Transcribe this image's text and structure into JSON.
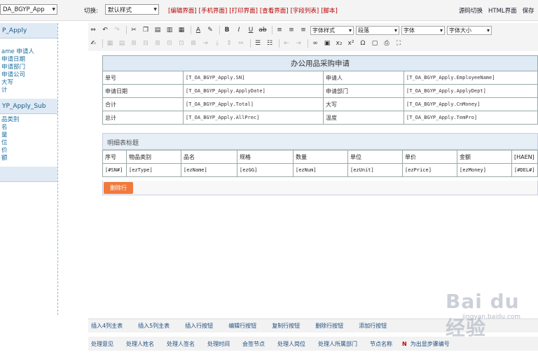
{
  "topbar": {
    "form_select": "DA_BGYP_App",
    "mode_label": "切换:",
    "style_select": "默认样式",
    "view_tabs": [
      "[编辑界面]",
      "[手机界面]",
      "[打印界面]",
      "[查看界面]",
      "[字段列表]",
      "[脚本]"
    ],
    "right_links": [
      "源码切换",
      "HTML界面",
      "保存"
    ]
  },
  "sidebar": {
    "group1_title": "P_Apply",
    "group1_items": [
      "ame 申请人",
      "申请日期",
      "申请部门",
      "",
      "",
      "申请公司",
      "大写",
      "",
      "计"
    ],
    "group2_title": "YP_Apply_Sub",
    "group2_items": [
      "品类别",
      "名",
      "",
      "量",
      "位",
      "价",
      "额"
    ]
  },
  "toolbar": {
    "font_style_select": "字体样式",
    "para_select": "段落",
    "font_select": "字体",
    "font_size_select": "字体大小"
  },
  "main_table": {
    "title": "办公用品采购申请",
    "rows": [
      [
        "单号",
        "[T_OA_BGYP_Apply.SN]",
        "申请人",
        "[T_OA_BGYP_Apply.EmployeeName]"
      ],
      [
        "申请日期",
        "[T_OA_BGYP_Apply.ApplyDate]",
        "申请部门",
        "[T_OA_BGYP_Apply.ApplyDept]"
      ],
      [
        "合计",
        "[T_OA_BGYP_Apply.Total]",
        "大写",
        "[T_OA_BGYP_Apply.CnMoney]"
      ],
      [
        "总计",
        "[T_OA_BGYP_Apply.AllPrec]",
        "温度",
        "[T_OA_BGYP_Apply.TemPro]"
      ]
    ]
  },
  "detail_table": {
    "title": "明细表标题",
    "headers": [
      "序号",
      "物品类别",
      "品名",
      "规格",
      "数量",
      "单位",
      "单价",
      "金额",
      "[HAEN]"
    ],
    "row": [
      "[#SN#]",
      "[ezType]",
      "[ezName]",
      "[ezGG]",
      "[ezNum]",
      "[ezUnit]",
      "[ezPrice]",
      "[ezMoney]",
      "[#DEL#]"
    ],
    "delete_button": "删除行"
  },
  "bottom_actions": [
    "插入4列主表",
    "插入5列主表",
    "插入行按钮",
    "编辑行按钮",
    "复制行按钮",
    "删除行按钮",
    "添加行按钮"
  ],
  "bottom_fields": [
    "处理意见",
    "处理人姓名",
    "处理人签名",
    "处理时间",
    "会签节点",
    "处理人岗位",
    "处理人所属部门",
    "节点名称"
  ],
  "bottom_next": "N",
  "bottom_next_label": "为出显步骤编号",
  "watermark": "Bai du 经验",
  "watermark_sub": "jingyan.baidu.com"
}
